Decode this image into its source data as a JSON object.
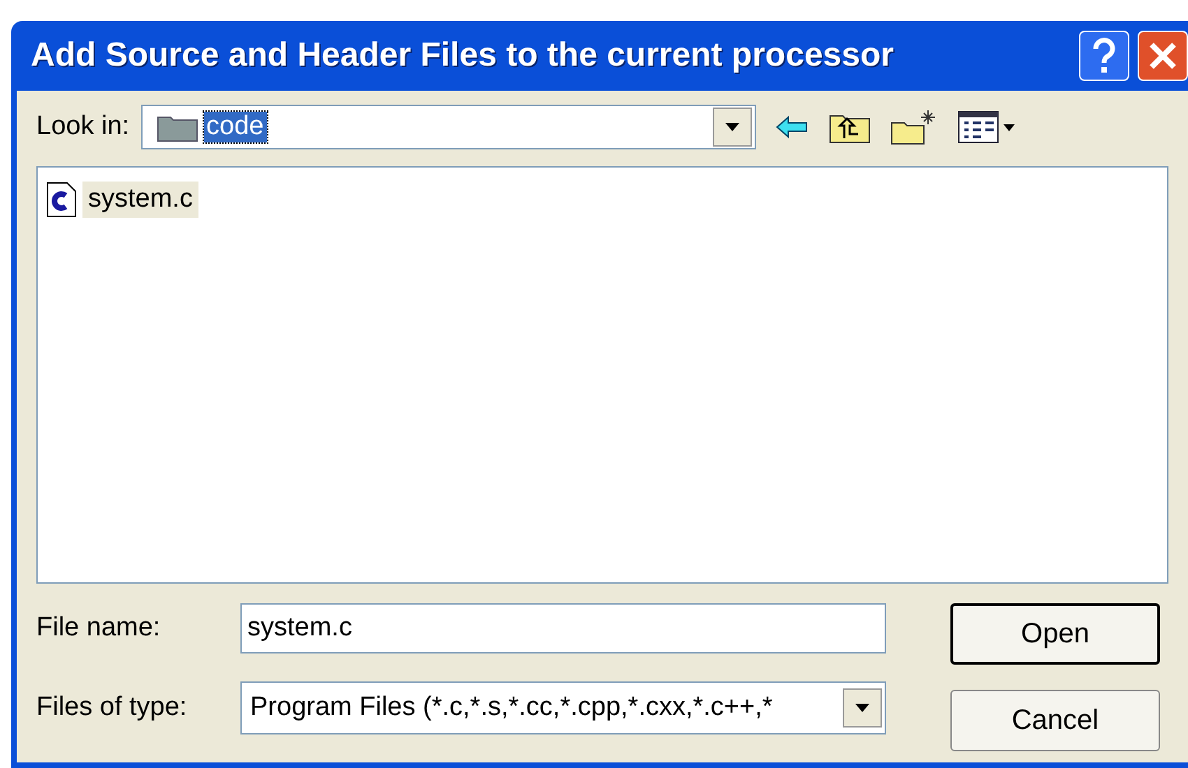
{
  "window": {
    "title": "Add Source and Header Files to the current processor"
  },
  "look_in": {
    "label": "Look in:",
    "value": "code"
  },
  "files": [
    {
      "name": "system.c",
      "selected": true
    }
  ],
  "file_name": {
    "label": "File name:",
    "value": "system.c"
  },
  "files_of_type": {
    "label": "Files of type:",
    "value": "Program Files (*.c,*.s,*.cc,*.cpp,*.cxx,*.c++,*"
  },
  "buttons": [
    {
      "label": "Open",
      "default": true
    },
    {
      "label": "Cancel",
      "default": false
    }
  ]
}
